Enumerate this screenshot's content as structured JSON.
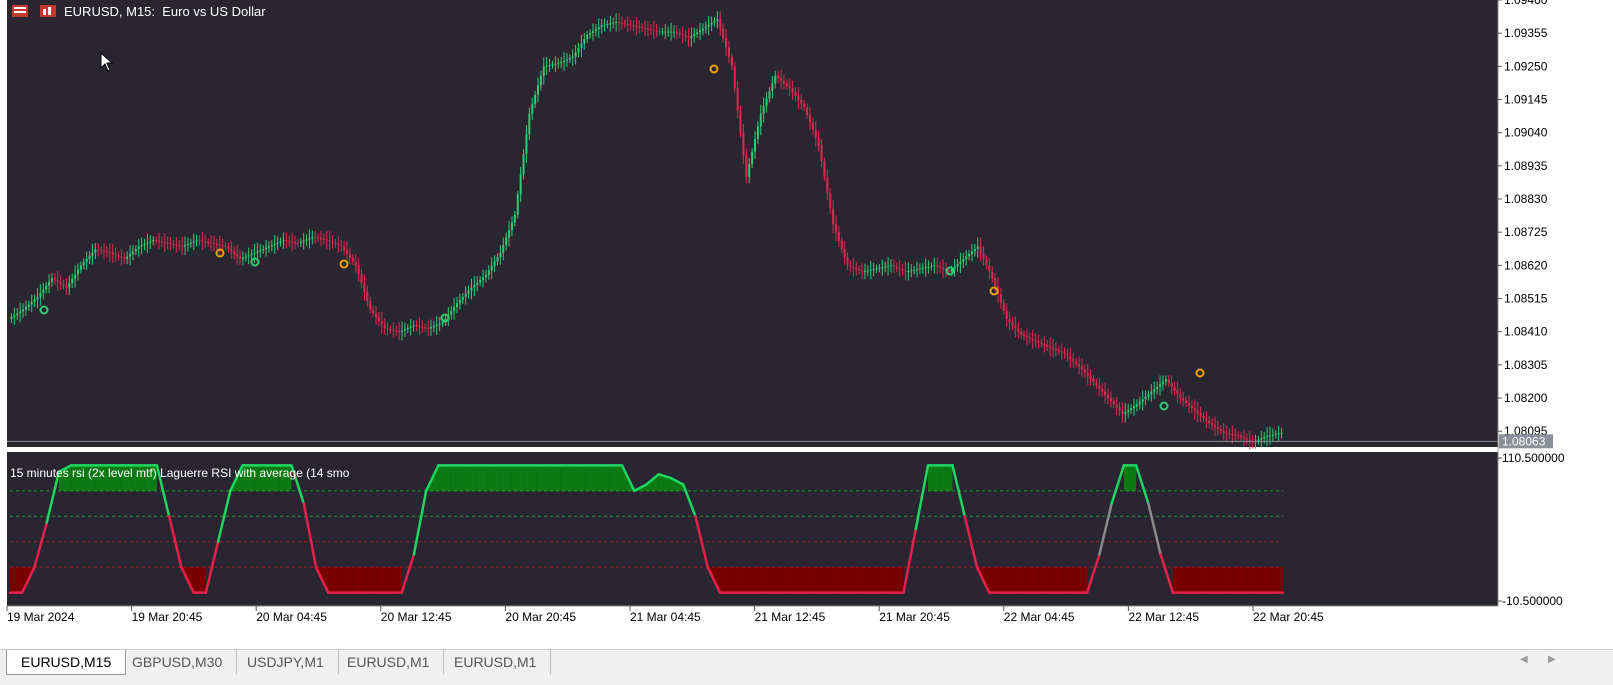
{
  "window": {
    "title": "EURUSD, M15:  Euro vs US Dollar",
    "indicator_title": "15 minutes rsi (2x level mtf) Laguerre RSI with average (14 smo"
  },
  "colors": {
    "background": "#2a2631",
    "up_candle": "#2ecc71",
    "down_candle": "#e0284f",
    "rsi_high": "#1ed760",
    "rsi_low": "#e8204a",
    "rsi_mid": "#8a8a8a",
    "zone_high": "#0b7a12",
    "zone_low": "#7a0000",
    "level_high": "#1f9c2e",
    "level_low": "#a02020",
    "arrow_up": "#2ecc71",
    "arrow_down": "#f0a000"
  },
  "price_axis": {
    "ticks": [
      "1.09460",
      "1.09355",
      "1.09250",
      "1.09145",
      "1.09040",
      "1.08935",
      "1.08830",
      "1.08725",
      "1.08620",
      "1.08515",
      "1.08410",
      "1.08305",
      "1.08200",
      "1.08095"
    ],
    "current_price": "1.08063"
  },
  "indicator_axis": {
    "ticks": [
      "110.500000",
      "-10.500000"
    ]
  },
  "time_axis": {
    "labels": [
      "19 Mar 2024",
      "19 Mar 20:45",
      "20 Mar 04:45",
      "20 Mar 12:45",
      "20 Mar 20:45",
      "21 Mar 04:45",
      "21 Mar 12:45",
      "21 Mar 20:45",
      "22 Mar 04:45",
      "22 Mar 12:45",
      "22 Mar 20:45"
    ]
  },
  "tabs": [
    {
      "label": "EURUSD,M15",
      "active": true
    },
    {
      "label": "GBPUSD,M30",
      "active": false
    },
    {
      "label": "USDJPY,M1",
      "active": false
    },
    {
      "label": "EURUSD,M1",
      "active": false
    },
    {
      "label": "EURUSD,M1",
      "active": false
    }
  ],
  "chart_data": [
    {
      "type": "line",
      "series": [
        {
          "values": [
            1.0845,
            1.0848,
            1.0852,
            1.0858,
            1.0855,
            1.0862,
            1.0867,
            1.0866,
            1.0864,
            1.0868,
            1.087,
            1.0869,
            1.0868,
            1.087,
            1.0869,
            1.0868,
            1.0864,
            1.0866,
            1.0868,
            1.087,
            1.0869,
            1.0871,
            1.087,
            1.0868,
            1.0862,
            1.0848,
            1.0842,
            1.0841,
            1.0843,
            1.0842,
            1.0844,
            1.085,
            1.0855,
            1.0859,
            1.0866,
            1.0878,
            1.091,
            1.0925,
            1.0926,
            1.0928,
            1.0935,
            1.0938,
            1.0939,
            1.0938,
            1.0937,
            1.0936,
            1.0936,
            1.0934,
            1.0937,
            1.094,
            1.0925,
            1.089,
            1.091,
            1.0922,
            1.0918,
            1.0912,
            1.09,
            1.0875,
            1.0862,
            1.086,
            1.0861,
            1.0862,
            1.086,
            1.0861,
            1.0862,
            1.086,
            1.0864,
            1.0868,
            1.0858,
            1.0845,
            1.084,
            1.0838,
            1.0836,
            1.0834,
            1.083,
            1.0825,
            1.082,
            1.0815,
            1.0818,
            1.0822,
            1.0826,
            1.082,
            1.0816,
            1.0812,
            1.0809,
            1.0808,
            1.0806,
            1.0808,
            1.0809
          ]
        }
      ],
      "ylim": [
        1.08045,
        1.0946
      ]
    },
    {
      "type": "line",
      "series": [
        {
          "values": [
            0,
            0,
            20,
            55,
            95,
            100,
            100,
            100,
            100,
            100,
            100,
            100,
            100,
            60,
            20,
            0,
            0,
            40,
            80,
            100,
            100,
            100,
            100,
            100,
            70,
            20,
            0,
            0,
            0,
            0,
            0,
            0,
            0,
            30,
            80,
            100,
            100,
            100,
            100,
            100,
            100,
            100,
            100,
            100,
            100,
            100,
            100,
            100,
            100,
            100,
            100,
            80,
            85,
            93,
            90,
            85,
            60,
            20,
            0,
            0,
            0,
            0,
            0,
            0,
            0,
            0,
            0,
            0,
            0,
            0,
            0,
            0,
            0,
            0,
            50,
            100,
            100,
            100,
            60,
            20,
            0,
            0,
            0,
            0,
            0,
            0,
            0,
            0,
            0,
            30,
            70,
            100,
            100,
            70,
            30,
            0,
            0,
            0,
            0,
            0,
            0,
            0,
            0,
            0,
            0
          ]
        }
      ],
      "ylim": [
        -10.5,
        110.5
      ]
    }
  ]
}
